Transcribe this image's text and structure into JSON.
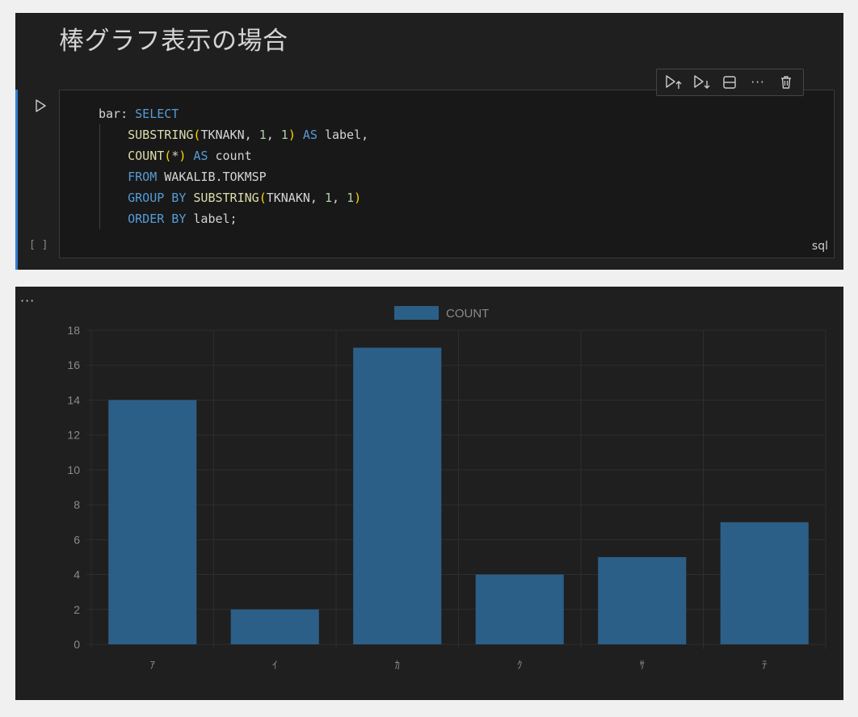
{
  "markdown": {
    "heading": "棒グラフ表示の場合"
  },
  "cell": {
    "execution_count": "[ ]",
    "language": "sql",
    "code_lines": [
      [
        {
          "t": "bar: ",
          "c": "plain"
        },
        {
          "t": "SELECT",
          "c": "kw"
        }
      ],
      [
        {
          "t": "    ",
          "c": "plain"
        },
        {
          "t": "SUBSTRING",
          "c": "fn"
        },
        {
          "t": "(",
          "c": "par"
        },
        {
          "t": "TKNAKN, ",
          "c": "plain"
        },
        {
          "t": "1",
          "c": "num"
        },
        {
          "t": ", ",
          "c": "plain"
        },
        {
          "t": "1",
          "c": "num"
        },
        {
          "t": ")",
          "c": "par"
        },
        {
          "t": " ",
          "c": "plain"
        },
        {
          "t": "AS",
          "c": "kw"
        },
        {
          "t": " label,",
          "c": "plain"
        }
      ],
      [
        {
          "t": "    ",
          "c": "plain"
        },
        {
          "t": "COUNT",
          "c": "fn"
        },
        {
          "t": "(",
          "c": "par"
        },
        {
          "t": "*",
          "c": "plain"
        },
        {
          "t": ")",
          "c": "par"
        },
        {
          "t": " ",
          "c": "plain"
        },
        {
          "t": "AS",
          "c": "kw"
        },
        {
          "t": " count",
          "c": "plain"
        }
      ],
      [
        {
          "t": "    ",
          "c": "plain"
        },
        {
          "t": "FROM",
          "c": "kw"
        },
        {
          "t": " WAKALIB.TOKMSP",
          "c": "plain"
        }
      ],
      [
        {
          "t": "    ",
          "c": "plain"
        },
        {
          "t": "GROUP BY",
          "c": "kw"
        },
        {
          "t": " ",
          "c": "plain"
        },
        {
          "t": "SUBSTRING",
          "c": "fn"
        },
        {
          "t": "(",
          "c": "par"
        },
        {
          "t": "TKNAKN, ",
          "c": "plain"
        },
        {
          "t": "1",
          "c": "num"
        },
        {
          "t": ", ",
          "c": "plain"
        },
        {
          "t": "1",
          "c": "num"
        },
        {
          "t": ")",
          "c": "par"
        }
      ],
      [
        {
          "t": "    ",
          "c": "plain"
        },
        {
          "t": "ORDER BY",
          "c": "kw"
        },
        {
          "t": " label;",
          "c": "plain"
        }
      ]
    ],
    "toolbar": {
      "icons": [
        "run-above-icon",
        "run-below-icon",
        "split-cell-icon",
        "more-icon",
        "delete-icon"
      ],
      "more_label": "···"
    }
  },
  "output": {
    "more_label": "···"
  },
  "colors": {
    "bar": "#2c5f87",
    "grid": "#2e2e2e",
    "tick": "#8a8a8a",
    "accent": "#2f7fd6"
  },
  "chart_data": {
    "type": "bar",
    "categories": [
      "ｱ",
      "ｲ",
      "ｶ",
      "ｸ",
      "ｻ",
      "ﾃ"
    ],
    "series": [
      {
        "name": "COUNT",
        "values": [
          14,
          2,
          17,
          4,
          5,
          7
        ]
      }
    ],
    "ylim": [
      0,
      18
    ],
    "yticks": [
      0,
      2,
      4,
      6,
      8,
      10,
      12,
      14,
      16,
      18
    ],
    "legend": "top-center",
    "grid": true,
    "title": "",
    "xlabel": "",
    "ylabel": ""
  }
}
